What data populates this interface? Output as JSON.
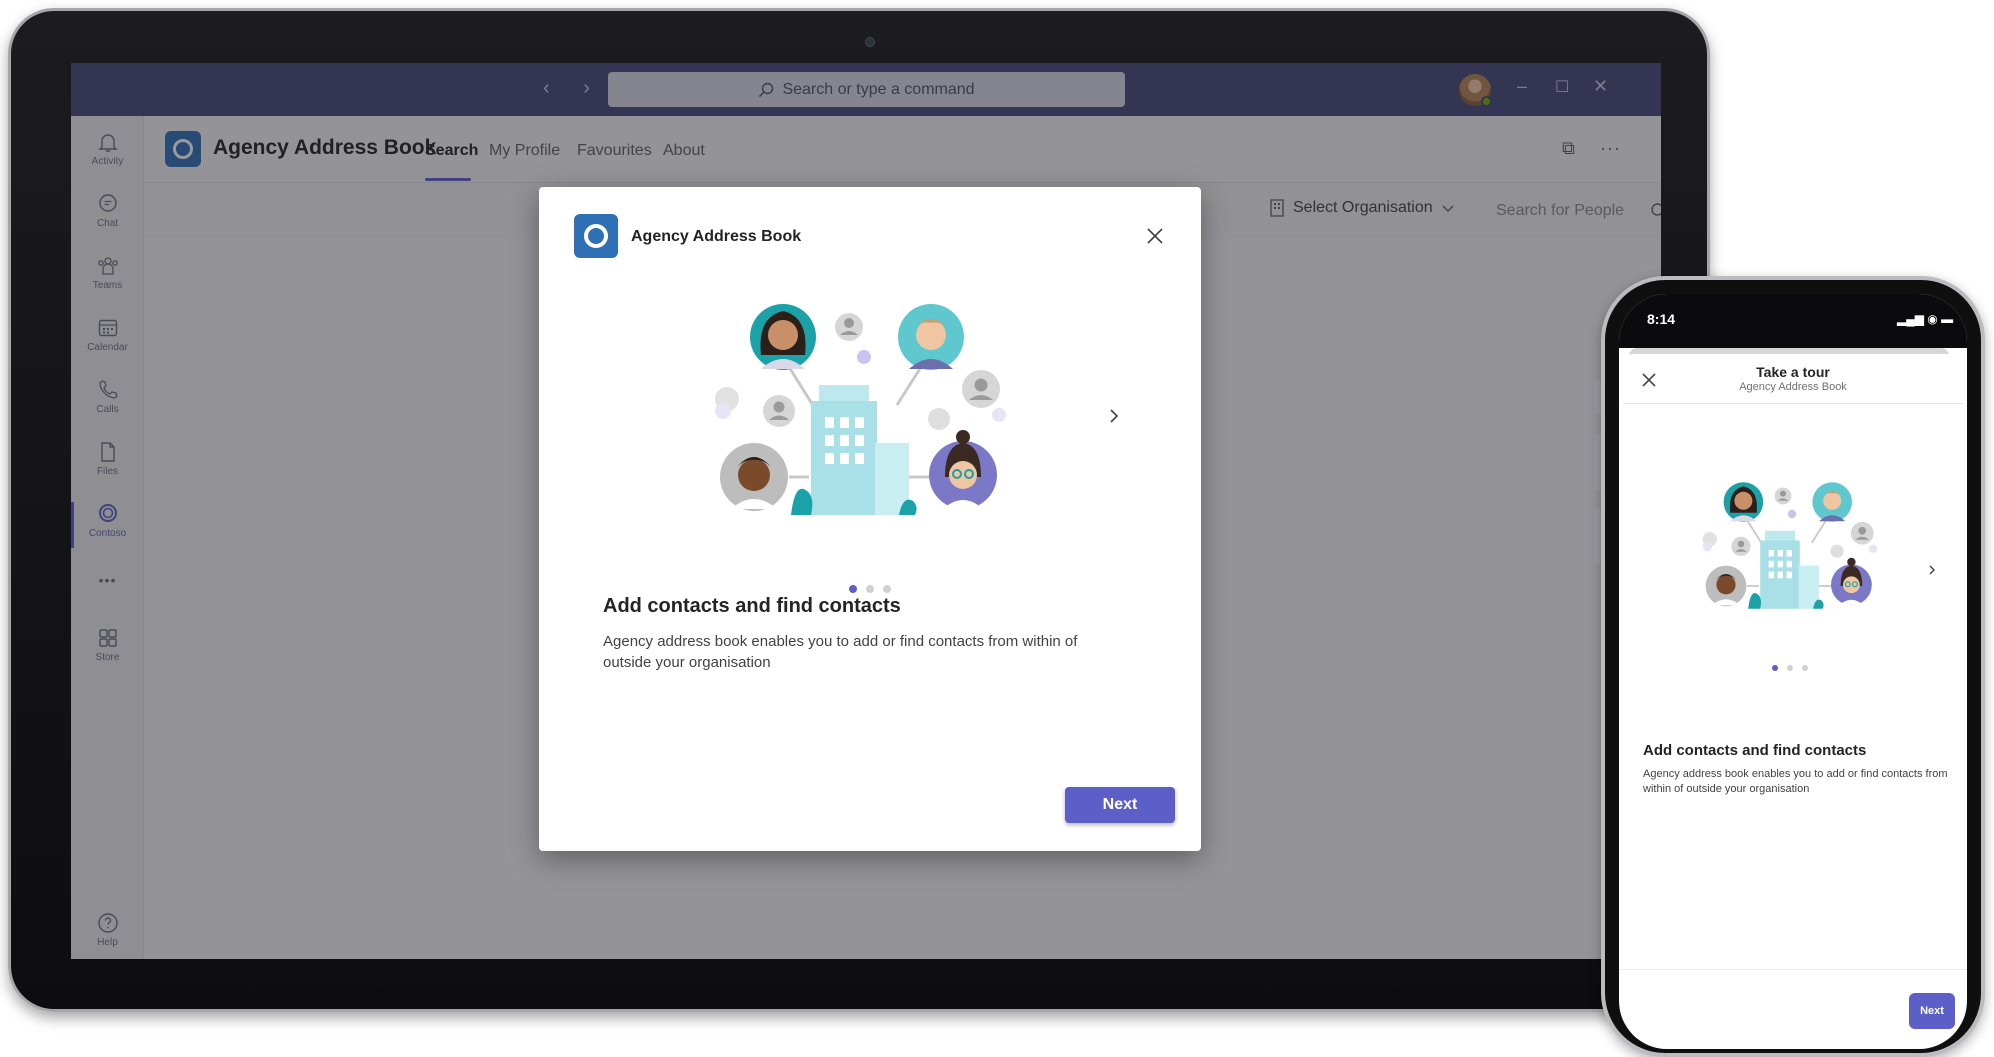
{
  "titlebar": {
    "search_placeholder": "Search or type a command",
    "minimize": "–",
    "maximize": "☐",
    "close": "✕",
    "nav_arrows": "‹ ›"
  },
  "rail": {
    "items": [
      {
        "label": "Activity",
        "icon": "bell-icon"
      },
      {
        "label": "Chat",
        "icon": "chat-icon"
      },
      {
        "label": "Teams",
        "icon": "teams-icon"
      },
      {
        "label": "Calendar",
        "icon": "calendar-icon"
      },
      {
        "label": "Calls",
        "icon": "phone-icon"
      },
      {
        "label": "Files",
        "icon": "file-icon"
      },
      {
        "label": "Contoso",
        "icon": "contoso-icon",
        "active": true
      },
      {
        "label": "",
        "icon": "more-icon"
      },
      {
        "label": "Store",
        "icon": "store-icon"
      },
      {
        "label": "Help",
        "icon": "help-icon"
      }
    ],
    "more_glyph": "•••"
  },
  "app": {
    "name": "Agency Address Book",
    "tabs": [
      {
        "label": "Search",
        "active": true
      },
      {
        "label": "My Profile"
      },
      {
        "label": "Favourites"
      },
      {
        "label": "About"
      }
    ],
    "popout_glyph": "⧉",
    "more_glyph": "···"
  },
  "toolbar": {
    "select_org": "Select Organisation",
    "search_people_placeholder": "Search for People"
  },
  "dialog": {
    "title": "Agency Address Book",
    "heading": "Add contacts and find contacts",
    "body": "Agency address book enables you to add or find contacts from within of outside your organisation",
    "next_label": "Next",
    "carousel": {
      "current": 1,
      "total": 3
    }
  },
  "phone": {
    "time": "8:14",
    "status_icons": "▂▄▆ ◉ ▬",
    "title": "Take a tour",
    "subtitle": "Agency Address Book",
    "heading": "Add contacts and find contacts",
    "body": "Agency address book enables you to add or find contacts from within of outside your organisation",
    "next_label": "Next"
  },
  "colors": {
    "teams_purple": "#464775",
    "accent": "#5b5fc7",
    "app_blue": "#2f6fb5"
  }
}
